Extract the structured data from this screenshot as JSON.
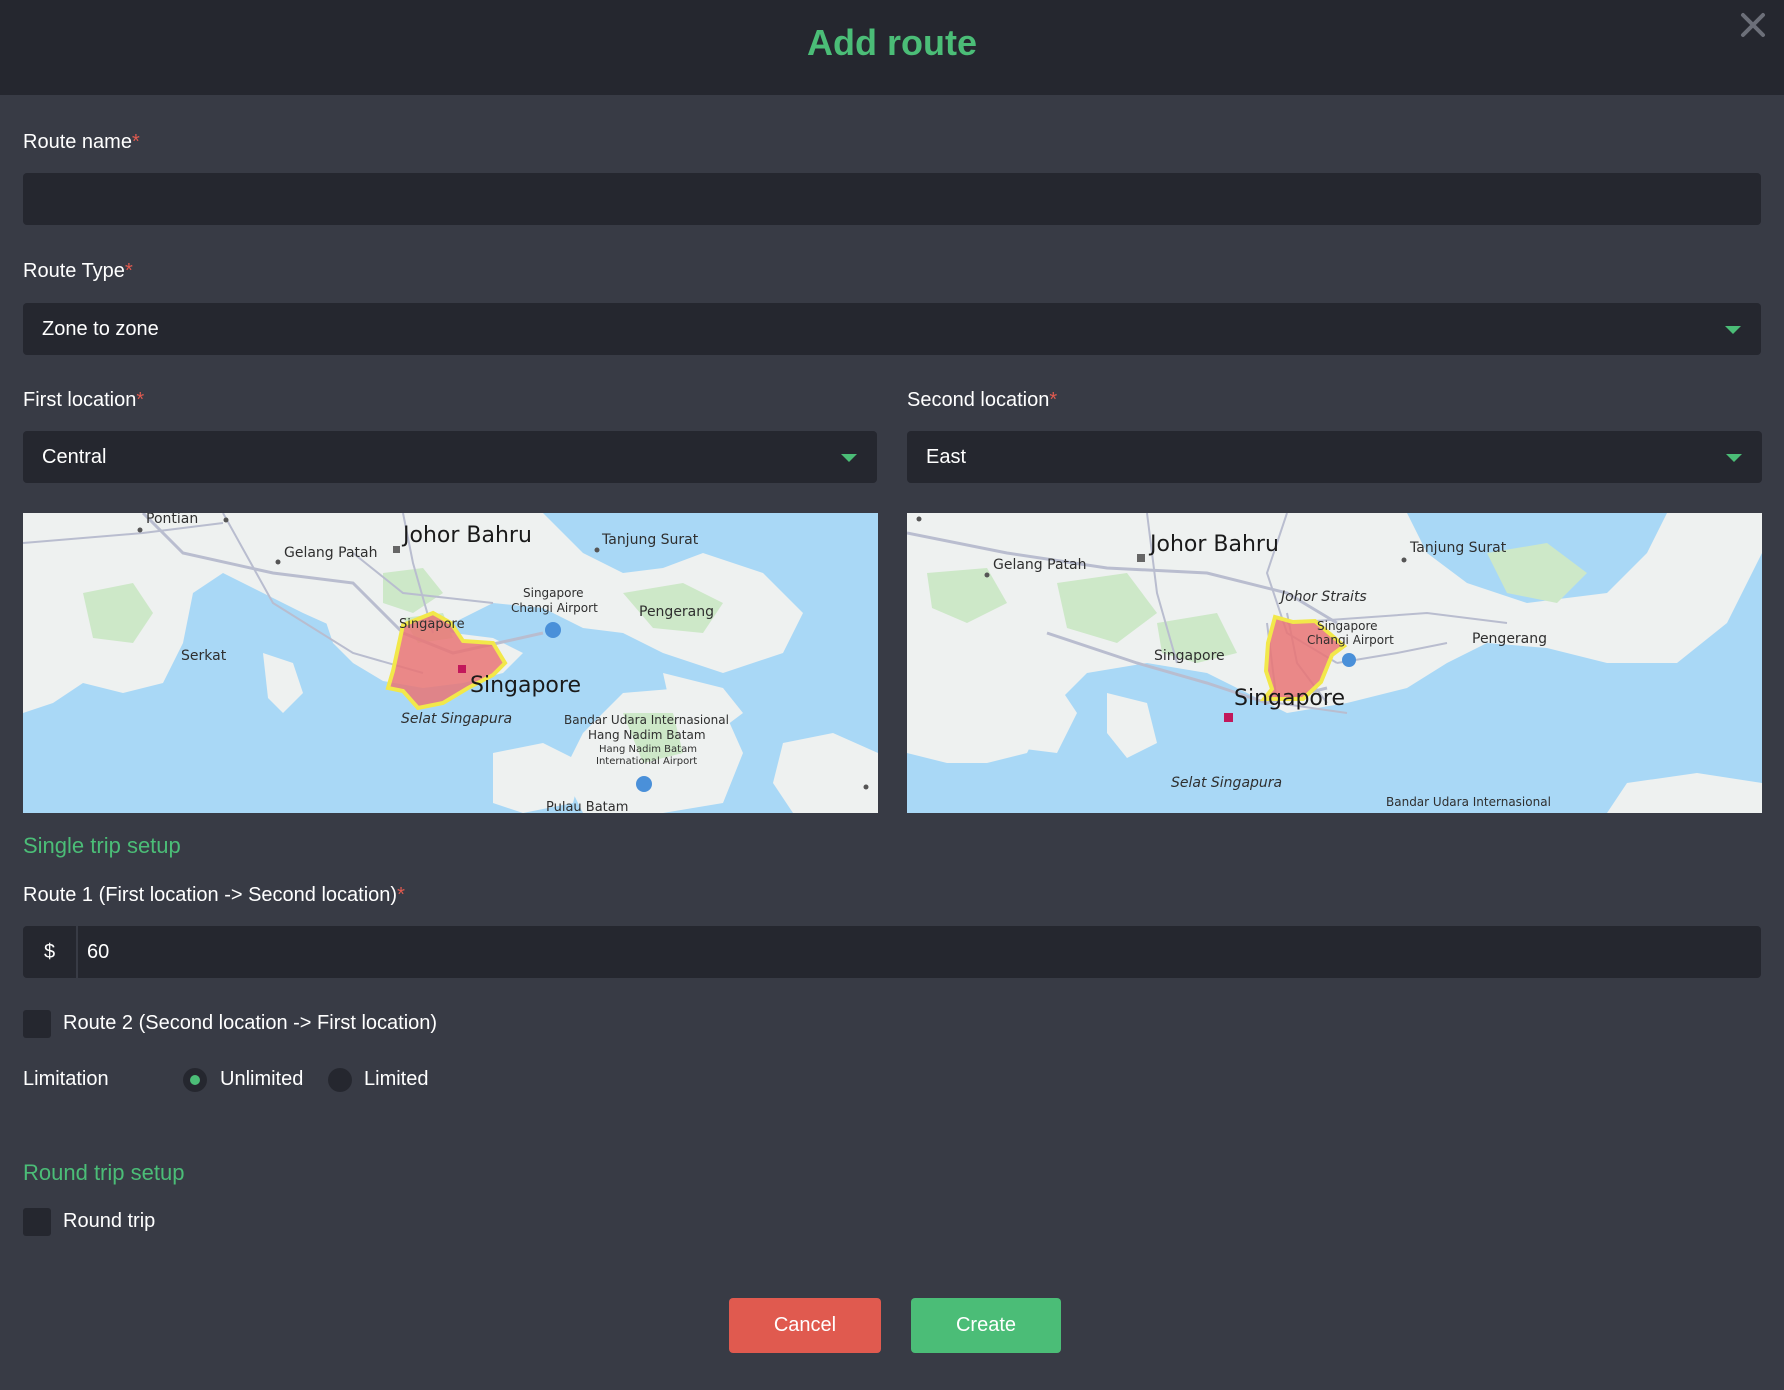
{
  "dialog": {
    "title": "Add route",
    "close_icon": "close-icon"
  },
  "form": {
    "route_name": {
      "label": "Route name",
      "value": ""
    },
    "route_type": {
      "label": "Route Type",
      "value": "Zone to zone"
    },
    "first_location": {
      "label": "First location",
      "value": "Central"
    },
    "second_location": {
      "label": "Second location",
      "value": "East"
    },
    "required_mark": "*"
  },
  "map1": {
    "labels": {
      "pontian": "Pontian",
      "johor_bahru": "Johor Bahru",
      "gelang_patah": "Gelang Patah",
      "tanjung_surat": "Tanjung Surat",
      "singapore_airport": "Singapore",
      "changi_airport": "Changi Airport",
      "pengerang": "Pengerang",
      "serkat": "Serkat",
      "singapore": "Singapore",
      "singa": "Singapore",
      "selat": "Selat Singapura",
      "bandar": "Bandar Udara Internasional",
      "hang_nadim": "Hang Nadim Batam",
      "hang_nadim_small": "Hang Nadim Batam",
      "intl_airport": "International Airport",
      "pulau_batam": "Pulau Batam"
    }
  },
  "map2": {
    "labels": {
      "johor_bahru": "Johor Bahru",
      "gelang_patah": "Gelang Patah",
      "tanjung_surat": "Tanjung Surat",
      "johor_straits": "Johor Straits",
      "singapore_airport": "Singapore",
      "changi_airport": "Changi Airport",
      "pengerang": "Pengerang",
      "singapore_small": "Singapore",
      "singapore": "Singapore",
      "selat": "Selat Singapura",
      "bandar": "Bandar Udara Internasional"
    }
  },
  "single_trip": {
    "heading": "Single trip setup",
    "route1_label": "Route 1 (First location -> Second location)",
    "currency": "$",
    "route1_value": "60",
    "route2_label": "Route 2 (Second location -> First location)",
    "route2_checked": false,
    "limitation_label": "Limitation",
    "options": [
      "Unlimited",
      "Limited"
    ],
    "selected": "Unlimited"
  },
  "round_trip": {
    "heading": "Round trip setup",
    "checkbox_label": "Round trip",
    "checked": false
  },
  "actions": {
    "cancel": "Cancel",
    "create": "Create"
  },
  "colors": {
    "accent": "#4bbd77",
    "cancel": "#e05a4f",
    "zone_fill": "#e97575",
    "zone_border": "#f2e84a"
  }
}
